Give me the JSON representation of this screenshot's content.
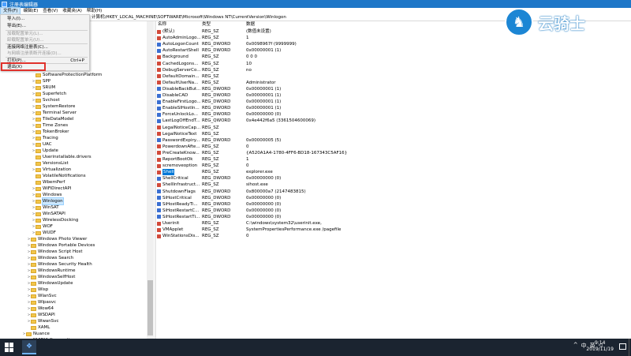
{
  "window": {
    "title": "注册表编辑器"
  },
  "menus": [
    "文件(F)",
    "编辑(E)",
    "查看(V)",
    "收藏夹(A)",
    "帮助(H)"
  ],
  "address": "计算机\\HKEY_LOCAL_MACHINE\\SOFTWARE\\Microsoft\\Windows NT\\CurrentVersion\\Winlogon",
  "file_menu": {
    "items": [
      {
        "label": "导入(I)...",
        "disabled": false
      },
      {
        "label": "导出(E)...",
        "disabled": false
      },
      {
        "label": "加载配置单元(L)...",
        "disabled": true
      },
      {
        "label": "卸载配置单元(U)...",
        "disabled": true
      },
      {
        "label": "连接网络注册表(C)...",
        "disabled": false
      },
      {
        "label": "与网络注册表断开连接(D)...",
        "disabled": true
      },
      {
        "label": "打印(P)...",
        "disabled": false,
        "shortcut": "Ctrl+P"
      },
      {
        "label": "退出(X)",
        "disabled": false
      }
    ]
  },
  "tree": {
    "items": [
      {
        "label": "SoftwareProtectionPlatform",
        "indent": 2,
        "arrow": ""
      },
      {
        "label": "SPP",
        "indent": 2,
        "arrow": ">"
      },
      {
        "label": "SRUM",
        "indent": 2,
        "arrow": ">"
      },
      {
        "label": "Superfetch",
        "indent": 2,
        "arrow": ">"
      },
      {
        "label": "Svchost",
        "indent": 2,
        "arrow": ">"
      },
      {
        "label": "SystemRestore",
        "indent": 2,
        "arrow": ">"
      },
      {
        "label": "Terminal Server",
        "indent": 2,
        "arrow": ">"
      },
      {
        "label": "TileDataModel",
        "indent": 2,
        "arrow": ">"
      },
      {
        "label": "Time Zones",
        "indent": 2,
        "arrow": ">"
      },
      {
        "label": "TokenBroker",
        "indent": 2,
        "arrow": ">"
      },
      {
        "label": "Tracing",
        "indent": 2,
        "arrow": ">"
      },
      {
        "label": "UAC",
        "indent": 2,
        "arrow": ">"
      },
      {
        "label": "Update",
        "indent": 2,
        "arrow": ">"
      },
      {
        "label": "Userinstallable.drivers",
        "indent": 2,
        "arrow": ""
      },
      {
        "label": "VersionsList",
        "indent": 2,
        "arrow": ""
      },
      {
        "label": "Virtualization",
        "indent": 2,
        "arrow": ">"
      },
      {
        "label": "VolatileNotifications",
        "indent": 2,
        "arrow": ""
      },
      {
        "label": "WbemPerf",
        "indent": 2,
        "arrow": ""
      },
      {
        "label": "WiFiDirectAPI",
        "indent": 2,
        "arrow": ">"
      },
      {
        "label": "Windows",
        "indent": 2,
        "arrow": ">"
      },
      {
        "label": "Winlogon",
        "indent": 2,
        "arrow": ">",
        "selected": true
      },
      {
        "label": "WinSAT",
        "indent": 2,
        "arrow": ">"
      },
      {
        "label": "WinSATAPI",
        "indent": 2,
        "arrow": ">"
      },
      {
        "label": "WirelessDocking",
        "indent": 2,
        "arrow": ">"
      },
      {
        "label": "WOF",
        "indent": 2,
        "arrow": ">"
      },
      {
        "label": "WUDF",
        "indent": 2,
        "arrow": ">"
      },
      {
        "label": "Windows Photo Viewer",
        "indent": 1,
        "arrow": ">"
      },
      {
        "label": "Windows Portable Devices",
        "indent": 1,
        "arrow": ">"
      },
      {
        "label": "Windows Script Host",
        "indent": 1,
        "arrow": ">"
      },
      {
        "label": "Windows Search",
        "indent": 1,
        "arrow": ">"
      },
      {
        "label": "Windows Security Health",
        "indent": 1,
        "arrow": ">"
      },
      {
        "label": "WindowsRuntime",
        "indent": 1,
        "arrow": ">"
      },
      {
        "label": "WindowsSelfHost",
        "indent": 1,
        "arrow": ">"
      },
      {
        "label": "WindowsUpdate",
        "indent": 1,
        "arrow": ">"
      },
      {
        "label": "Wisp",
        "indent": 1,
        "arrow": ">"
      },
      {
        "label": "WlanSvc",
        "indent": 1,
        "arrow": ">"
      },
      {
        "label": "Wlpasvc",
        "indent": 1,
        "arrow": ">"
      },
      {
        "label": "Wow64",
        "indent": 1,
        "arrow": ">"
      },
      {
        "label": "WSDAPI",
        "indent": 1,
        "arrow": ">"
      },
      {
        "label": "WwanSvc",
        "indent": 1,
        "arrow": ">"
      },
      {
        "label": "XAML",
        "indent": 1,
        "arrow": ""
      },
      {
        "label": "Nuance",
        "indent": 0,
        "arrow": ">"
      },
      {
        "label": "NVIDIA Corporation",
        "indent": 0,
        "arrow": ">"
      }
    ]
  },
  "values": {
    "columns": {
      "name": "名称",
      "type": "类型",
      "data": "数据"
    },
    "rows": [
      {
        "kind": "sz",
        "name": "(默认)",
        "type": "REG_SZ",
        "data": "(数值未设置)"
      },
      {
        "kind": "sz",
        "name": "AutoAdminLogo...",
        "type": "REG_SZ",
        "data": "1"
      },
      {
        "kind": "dw",
        "name": "AutoLogonCount",
        "type": "REG_DWORD",
        "data": "0x0098967f (9999999)"
      },
      {
        "kind": "dw",
        "name": "AutoRestartShell",
        "type": "REG_DWORD",
        "data": "0x00000001 (1)"
      },
      {
        "kind": "sz",
        "name": "Background",
        "type": "REG_SZ",
        "data": "0 0 0"
      },
      {
        "kind": "sz",
        "name": "CachedLogons...",
        "type": "REG_SZ",
        "data": "10"
      },
      {
        "kind": "sz",
        "name": "DebugServerCo...",
        "type": "REG_SZ",
        "data": "no"
      },
      {
        "kind": "sz",
        "name": "DefaultDomain...",
        "type": "REG_SZ",
        "data": ""
      },
      {
        "kind": "sz",
        "name": "DefaultUserNa...",
        "type": "REG_SZ",
        "data": "Administrator"
      },
      {
        "kind": "dw",
        "name": "DisableBackBut...",
        "type": "REG_DWORD",
        "data": "0x00000001 (1)"
      },
      {
        "kind": "dw",
        "name": "DisableCAD",
        "type": "REG_DWORD",
        "data": "0x00000001 (1)"
      },
      {
        "kind": "dw",
        "name": "EnableFirstLogo...",
        "type": "REG_DWORD",
        "data": "0x00000001 (1)"
      },
      {
        "kind": "dw",
        "name": "EnableSIHostIn...",
        "type": "REG_DWORD",
        "data": "0x00000001 (1)"
      },
      {
        "kind": "dw",
        "name": "ForceUnlockLo...",
        "type": "REG_DWORD",
        "data": "0x00000000 (0)"
      },
      {
        "kind": "dw",
        "name": "LastLogOffEndT...",
        "type": "REG_QWORD",
        "data": "0x4e442f6a5 (3361504600069)"
      },
      {
        "kind": "sz",
        "name": "LegalNoticeCap...",
        "type": "REG_SZ",
        "data": ""
      },
      {
        "kind": "sz",
        "name": "LegalNoticeText",
        "type": "REG_SZ",
        "data": ""
      },
      {
        "kind": "dw",
        "name": "PasswordExpiry...",
        "type": "REG_DWORD",
        "data": "0x00000005 (5)"
      },
      {
        "kind": "sz",
        "name": "PowerdownAfte...",
        "type": "REG_SZ",
        "data": "0"
      },
      {
        "kind": "sz",
        "name": "PreCreateKnow...",
        "type": "REG_SZ",
        "data": "{A520A1A4-1780-4FF6-BD18-167343C5AF16}"
      },
      {
        "kind": "sz",
        "name": "ReportBootOk",
        "type": "REG_SZ",
        "data": "1"
      },
      {
        "kind": "sz",
        "name": "scremoveoption",
        "type": "REG_SZ",
        "data": "0"
      },
      {
        "kind": "sz",
        "name": "Shell",
        "type": "REG_SZ",
        "data": "explorer.exe",
        "selected": true
      },
      {
        "kind": "dw",
        "name": "ShellCritical",
        "type": "REG_DWORD",
        "data": "0x00000000 (0)"
      },
      {
        "kind": "sz",
        "name": "ShellInfrastruct...",
        "type": "REG_SZ",
        "data": "sihost.exe"
      },
      {
        "kind": "dw",
        "name": "ShutdownFlags",
        "type": "REG_DWORD",
        "data": "0x800000a7 (2147483815)"
      },
      {
        "kind": "dw",
        "name": "SiHostCritical",
        "type": "REG_DWORD",
        "data": "0x00000000 (0)"
      },
      {
        "kind": "dw",
        "name": "SiHostReadyTi...",
        "type": "REG_DWORD",
        "data": "0x00000000 (0)"
      },
      {
        "kind": "dw",
        "name": "SiHostRestartC...",
        "type": "REG_DWORD",
        "data": "0x00000000 (0)"
      },
      {
        "kind": "dw",
        "name": "SiHostRestartTi...",
        "type": "REG_DWORD",
        "data": "0x00000000 (0)"
      },
      {
        "kind": "sz",
        "name": "Userinit",
        "type": "REG_SZ",
        "data": "C:\\windows\\system32\\userinit.exe,"
      },
      {
        "kind": "sz",
        "name": "VMApplet",
        "type": "REG_SZ",
        "data": "SystemPropertiesPerformance.exe /pagefile"
      },
      {
        "kind": "sz",
        "name": "WinStationsDis...",
        "type": "REG_SZ",
        "data": "0"
      }
    ]
  },
  "watermark": {
    "brand": "云骑士"
  },
  "taskbar": {
    "tray_icons": [
      "^",
      "中",
      "英"
    ],
    "time": "9:14",
    "date": "2019/11/19"
  },
  "colors": {
    "titlebar": "#1e77c8",
    "selection": "#0078d7",
    "exit_highlight": "#e0322c"
  }
}
